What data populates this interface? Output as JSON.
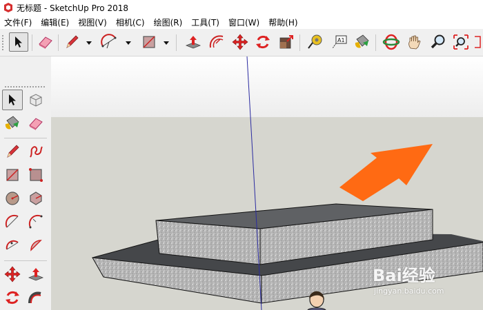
{
  "window": {
    "title": "无标题 - SketchUp Pro 2018",
    "app_icon": "sketchup-icon"
  },
  "menu": [
    {
      "label": "文件(F)"
    },
    {
      "label": "编辑(E)"
    },
    {
      "label": "视图(V)"
    },
    {
      "label": "相机(C)"
    },
    {
      "label": "绘图(R)"
    },
    {
      "label": "工具(T)"
    },
    {
      "label": "窗口(W)"
    },
    {
      "label": "帮助(H)"
    }
  ],
  "toolbar": {
    "buttons": [
      "select-arrow-icon",
      "eraser-icon",
      "pencil-icon",
      "arc-icon",
      "rectangle-icon",
      "push-pull-icon",
      "offset-icon",
      "move-icon",
      "rotate-icon",
      "scale-icon",
      "tape-measure-icon",
      "text-label-icon",
      "paint-bucket-icon",
      "orbit-icon",
      "pan-hand-icon",
      "zoom-icon",
      "zoom-extents-icon"
    ],
    "text_label_glyph": "A1"
  },
  "left_toolbar": {
    "buttons": [
      "select-arrow-icon",
      "make-component-icon",
      "paint-bucket-icon",
      "eraser-icon",
      "pencil-icon",
      "freehand-icon",
      "rectangle-icon",
      "rotated-rectangle-icon",
      "circle-icon",
      "polygon-icon",
      "arc-icon",
      "two-point-arc-icon",
      "three-point-arc-icon",
      "pie-icon",
      "move-icon",
      "push-pull-icon",
      "rotate-icon",
      "follow-me-icon"
    ]
  },
  "viewport": {
    "sky_color": "#f4f4f4",
    "ground_color": "#d6d6cf",
    "arrow_color": "#ff6a13",
    "axis_color": "#2a2aa0"
  },
  "watermark": {
    "logo": "Bai经验",
    "url": "jingyan.baidu.com"
  }
}
